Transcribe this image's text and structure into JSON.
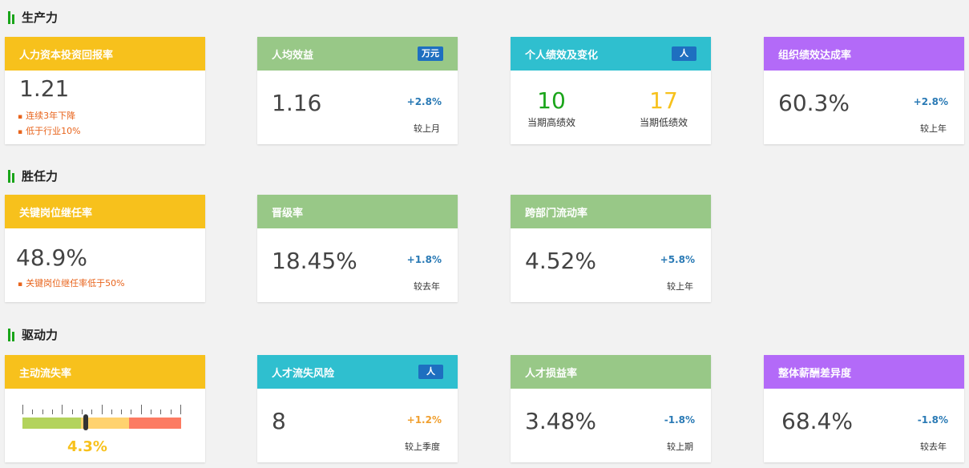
{
  "sections": [
    {
      "title": "生产力"
    },
    {
      "title": "胜任力"
    },
    {
      "title": "驱动力"
    }
  ],
  "productivity": {
    "roi": {
      "title": "人力资本投资回报率",
      "value": "1.21",
      "notes": [
        "连续3年下降",
        "低于行业10%"
      ]
    },
    "per_capita": {
      "title": "人均效益",
      "badge": "万元",
      "value": "1.16",
      "delta": "+2.8%",
      "compare": "较上月"
    },
    "performance": {
      "title": "个人绩效及变化",
      "badge": "人",
      "high_value": "10",
      "high_label": "当期高绩效",
      "low_value": "17",
      "low_label": "当期低绩效"
    },
    "org_rate": {
      "title": "组织绩效达成率",
      "value": "60.3%",
      "delta": "+2.8%",
      "compare": "较上年"
    }
  },
  "competence": {
    "succession": {
      "title": "关键岗位继任率",
      "value": "48.9%",
      "note": "关键岗位继任率低于50%"
    },
    "promotion": {
      "title": "晋级率",
      "value": "18.45%",
      "delta": "+1.8%",
      "compare": "较去年"
    },
    "mobility": {
      "title": "跨部门流动率",
      "value": "4.52%",
      "delta": "+5.8%",
      "compare": "较上年"
    }
  },
  "drive": {
    "turnover": {
      "title": "主动流失率",
      "value": "4.3%",
      "level": 0.4
    },
    "talent_risk": {
      "title": "人才流失风险",
      "badge": "人",
      "value": "8",
      "delta": "+1.2%",
      "compare": "较上季度"
    },
    "talent_loss": {
      "title": "人才损益率",
      "value": "3.48%",
      "delta": "-1.8%",
      "compare": "较上期"
    },
    "pay_gap": {
      "title": "整体薪酬差异度",
      "value": "68.4%",
      "delta": "-1.8%",
      "compare": "较去年"
    }
  },
  "colors": {
    "yellow": "#f7c11c",
    "green": "#98c887",
    "cyan": "#2fbfcf",
    "purple": "#b36af8",
    "badge": "#1e6fc0",
    "accent_green": "#1aa51a"
  }
}
